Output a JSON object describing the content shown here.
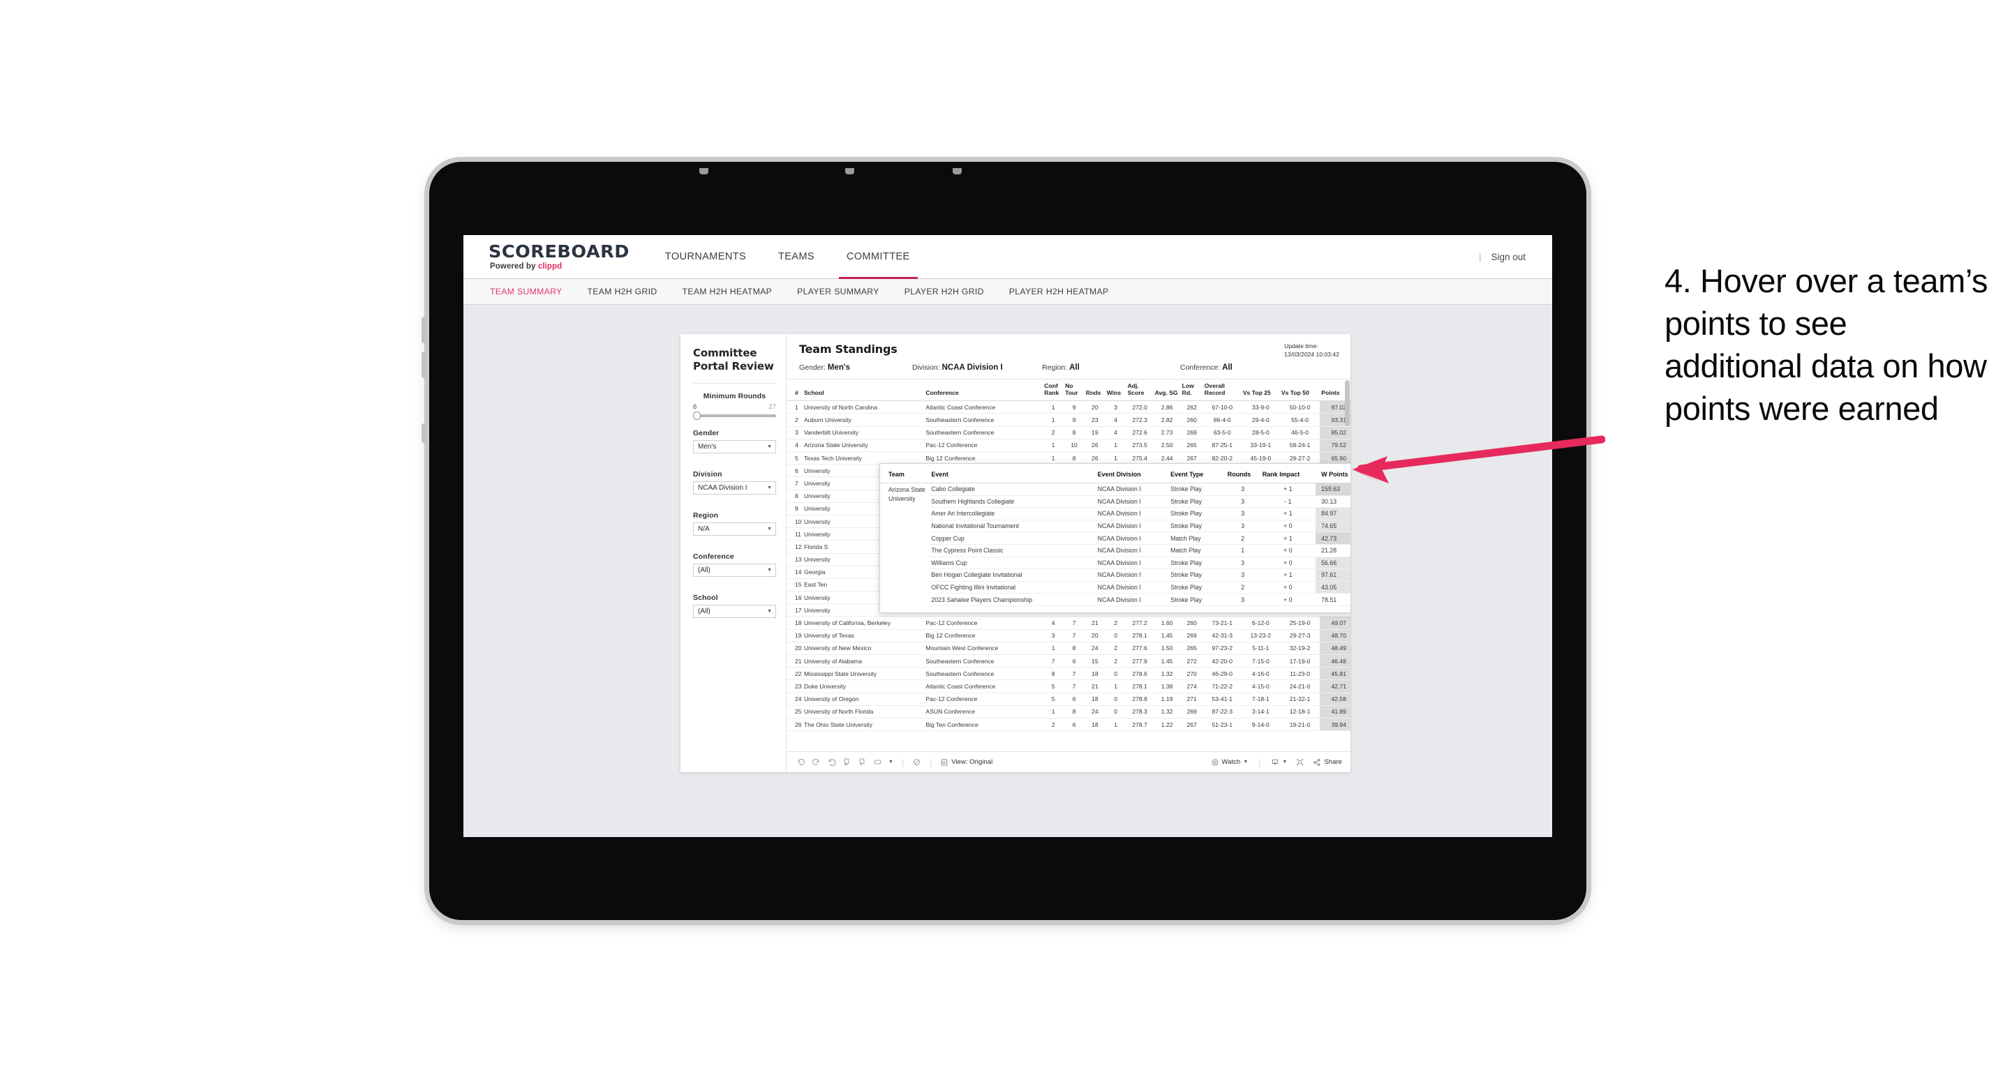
{
  "header": {
    "brand_name": "SCOREBOARD",
    "brand_sub_prefix": "Powered by ",
    "brand_sub_accent": "clippd",
    "nav": [
      {
        "label": "TOURNAMENTS",
        "active": false
      },
      {
        "label": "TEAMS",
        "active": false
      },
      {
        "label": "COMMITTEE",
        "active": true
      }
    ],
    "divider": "|",
    "sign_out": "Sign out"
  },
  "subnav": {
    "tabs": [
      {
        "label": "TEAM SUMMARY",
        "active": true
      },
      {
        "label": "TEAM H2H GRID",
        "active": false
      },
      {
        "label": "TEAM H2H HEATMAP",
        "active": false
      },
      {
        "label": "PLAYER SUMMARY",
        "active": false
      },
      {
        "label": "PLAYER H2H GRID",
        "active": false
      },
      {
        "label": "PLAYER H2H HEATMAP",
        "active": false
      }
    ]
  },
  "filters": {
    "title": "Committee Portal Review",
    "min_rounds": {
      "label": "Minimum Rounds",
      "min": "6",
      "max": "27"
    },
    "gender": {
      "label": "Gender",
      "value": "Men's"
    },
    "division": {
      "label": "Division",
      "value": "NCAA Division I"
    },
    "region": {
      "label": "Region",
      "value": "N/A"
    },
    "conference": {
      "label": "Conference",
      "value": "(All)"
    },
    "school": {
      "label": "School",
      "value": "(All)"
    }
  },
  "sheet": {
    "title": "Team Standings",
    "update_label": "Update time:",
    "update_value": "13/03/2024 10:03:42",
    "summary": [
      {
        "label": "Gender:",
        "value": "Men's"
      },
      {
        "label": "Division:",
        "value": "NCAA Division I"
      },
      {
        "label": "Region:",
        "value": "All"
      },
      {
        "label": "Conference:",
        "value": "All"
      }
    ]
  },
  "table": {
    "headers": {
      "rank": "#",
      "school": "School",
      "conference": "Conference",
      "conf_rank": "Conf Rank",
      "no_tour": "No Tour",
      "rnds": "Rnds",
      "wins": "Wins",
      "adj_score": "Adj. Score",
      "avg_sg": "Avg. SG",
      "low_rd": "Low Rd.",
      "overall_record": "Overall Record",
      "vs_top_25": "Vs Top 25",
      "vs_top_50": "Vs Top 50",
      "points": "Points"
    },
    "rows": [
      {
        "rank": "1",
        "school": "University of North Carolina",
        "conf": "Atlantic Coast Conference",
        "conf_rank": "1",
        "no_tour": "9",
        "rnds": "20",
        "wins": "3",
        "adj": "272.0",
        "sg": "2.86",
        "low": "262",
        "rec": "67-10-0",
        "t25": "33-9-0",
        "t50": "50-10-0",
        "pts": "97.02"
      },
      {
        "rank": "2",
        "school": "Auburn University",
        "conf": "Southeastern Conference",
        "conf_rank": "1",
        "no_tour": "9",
        "rnds": "23",
        "wins": "4",
        "adj": "272.3",
        "sg": "2.82",
        "low": "260",
        "rec": "86-4-0",
        "t25": "29-4-0",
        "t50": "55-4-0",
        "pts": "93.31"
      },
      {
        "rank": "3",
        "school": "Vanderbilt University",
        "conf": "Southeastern Conference",
        "conf_rank": "2",
        "no_tour": "8",
        "rnds": "19",
        "wins": "4",
        "adj": "272.6",
        "sg": "2.73",
        "low": "269",
        "rec": "63-5-0",
        "t25": "28-5-0",
        "t50": "46-5-0",
        "pts": "85.02"
      },
      {
        "rank": "4",
        "school": "Arizona State University",
        "conf": "Pac-12 Conference",
        "conf_rank": "1",
        "no_tour": "10",
        "rnds": "26",
        "wins": "1",
        "adj": "273.5",
        "sg": "2.50",
        "low": "265",
        "rec": "87-25-1",
        "t25": "33-19-1",
        "t50": "58-24-1",
        "pts": "79.52"
      },
      {
        "rank": "5",
        "school": "Texas Tech University",
        "conf": "Big 12 Conference",
        "conf_rank": "1",
        "no_tour": "8",
        "rnds": "26",
        "wins": "1",
        "adj": "275.4",
        "sg": "2.44",
        "low": "267",
        "rec": "82-20-2",
        "t25": "45-19-0",
        "t50": "29-27-2",
        "pts": "65.90"
      },
      {
        "rank": "6",
        "school": "University",
        "conf": "",
        "conf_rank": "",
        "no_tour": "",
        "rnds": "",
        "wins": "",
        "adj": "",
        "sg": "",
        "low": "",
        "rec": "",
        "t25": "",
        "t50": "",
        "pts": ""
      },
      {
        "rank": "7",
        "school": "University",
        "conf": "",
        "conf_rank": "",
        "no_tour": "",
        "rnds": "",
        "wins": "",
        "adj": "",
        "sg": "",
        "low": "",
        "rec": "",
        "t25": "",
        "t50": "",
        "pts": ""
      },
      {
        "rank": "8",
        "school": "University",
        "conf": "",
        "conf_rank": "",
        "no_tour": "",
        "rnds": "",
        "wins": "",
        "adj": "",
        "sg": "",
        "low": "",
        "rec": "",
        "t25": "",
        "t50": "",
        "pts": ""
      },
      {
        "rank": "9",
        "school": "University",
        "conf": "",
        "conf_rank": "",
        "no_tour": "",
        "rnds": "",
        "wins": "",
        "adj": "",
        "sg": "",
        "low": "",
        "rec": "",
        "t25": "",
        "t50": "",
        "pts": ""
      },
      {
        "rank": "10",
        "school": "University",
        "conf": "",
        "conf_rank": "",
        "no_tour": "",
        "rnds": "",
        "wins": "",
        "adj": "",
        "sg": "",
        "low": "",
        "rec": "",
        "t25": "",
        "t50": "",
        "pts": ""
      },
      {
        "rank": "11",
        "school": "University",
        "conf": "",
        "conf_rank": "",
        "no_tour": "",
        "rnds": "",
        "wins": "",
        "adj": "",
        "sg": "",
        "low": "",
        "rec": "",
        "t25": "",
        "t50": "",
        "pts": ""
      },
      {
        "rank": "12",
        "school": "Florida S",
        "conf": "",
        "conf_rank": "",
        "no_tour": "",
        "rnds": "",
        "wins": "",
        "adj": "",
        "sg": "",
        "low": "",
        "rec": "",
        "t25": "",
        "t50": "",
        "pts": ""
      },
      {
        "rank": "13",
        "school": "University",
        "conf": "",
        "conf_rank": "",
        "no_tour": "",
        "rnds": "",
        "wins": "",
        "adj": "",
        "sg": "",
        "low": "",
        "rec": "",
        "t25": "",
        "t50": "",
        "pts": ""
      },
      {
        "rank": "14",
        "school": "Georgia",
        "conf": "",
        "conf_rank": "",
        "no_tour": "",
        "rnds": "",
        "wins": "",
        "adj": "",
        "sg": "",
        "low": "",
        "rec": "",
        "t25": "",
        "t50": "",
        "pts": ""
      },
      {
        "rank": "15",
        "school": "East Ten",
        "conf": "",
        "conf_rank": "",
        "no_tour": "",
        "rnds": "",
        "wins": "",
        "adj": "",
        "sg": "",
        "low": "",
        "rec": "",
        "t25": "",
        "t50": "",
        "pts": ""
      },
      {
        "rank": "16",
        "school": "University",
        "conf": "",
        "conf_rank": "",
        "no_tour": "",
        "rnds": "",
        "wins": "",
        "adj": "",
        "sg": "",
        "low": "",
        "rec": "",
        "t25": "",
        "t50": "",
        "pts": ""
      },
      {
        "rank": "17",
        "school": "University",
        "conf": "",
        "conf_rank": "",
        "no_tour": "",
        "rnds": "",
        "wins": "",
        "adj": "",
        "sg": "",
        "low": "",
        "rec": "",
        "t25": "",
        "t50": "",
        "pts": ""
      },
      {
        "rank": "18",
        "school": "University of California, Berkeley",
        "conf": "Pac-12 Conference",
        "conf_rank": "4",
        "no_tour": "7",
        "rnds": "21",
        "wins": "2",
        "adj": "277.2",
        "sg": "1.60",
        "low": "260",
        "rec": "73-21-1",
        "t25": "6-12-0",
        "t50": "25-19-0",
        "pts": "49.07"
      },
      {
        "rank": "19",
        "school": "University of Texas",
        "conf": "Big 12 Conference",
        "conf_rank": "3",
        "no_tour": "7",
        "rnds": "20",
        "wins": "0",
        "adj": "278.1",
        "sg": "1.45",
        "low": "269",
        "rec": "42-31-3",
        "t25": "13-23-2",
        "t50": "29-27-3",
        "pts": "48.70"
      },
      {
        "rank": "20",
        "school": "University of New Mexico",
        "conf": "Mountain West Conference",
        "conf_rank": "1",
        "no_tour": "8",
        "rnds": "24",
        "wins": "2",
        "adj": "277.6",
        "sg": "1.50",
        "low": "265",
        "rec": "97-23-2",
        "t25": "5-11-1",
        "t50": "32-19-2",
        "pts": "48.49"
      },
      {
        "rank": "21",
        "school": "University of Alabama",
        "conf": "Southeastern Conference",
        "conf_rank": "7",
        "no_tour": "6",
        "rnds": "15",
        "wins": "2",
        "adj": "277.9",
        "sg": "1.45",
        "low": "272",
        "rec": "42-20-0",
        "t25": "7-15-0",
        "t50": "17-19-0",
        "pts": "46.48"
      },
      {
        "rank": "22",
        "school": "Mississippi State University",
        "conf": "Southeastern Conference",
        "conf_rank": "8",
        "no_tour": "7",
        "rnds": "18",
        "wins": "0",
        "adj": "278.6",
        "sg": "1.32",
        "low": "270",
        "rec": "46-29-0",
        "t25": "4-16-0",
        "t50": "11-23-0",
        "pts": "45.81"
      },
      {
        "rank": "23",
        "school": "Duke University",
        "conf": "Atlantic Coast Conference",
        "conf_rank": "5",
        "no_tour": "7",
        "rnds": "21",
        "wins": "1",
        "adj": "278.1",
        "sg": "1.38",
        "low": "274",
        "rec": "71-22-2",
        "t25": "4-15-0",
        "t50": "24-21-0",
        "pts": "42.71"
      },
      {
        "rank": "24",
        "school": "University of Oregon",
        "conf": "Pac-12 Conference",
        "conf_rank": "5",
        "no_tour": "6",
        "rnds": "18",
        "wins": "0",
        "adj": "278.8",
        "sg": "1.19",
        "low": "271",
        "rec": "53-41-1",
        "t25": "7-18-1",
        "t50": "21-32-1",
        "pts": "42.58"
      },
      {
        "rank": "25",
        "school": "University of North Florida",
        "conf": "ASUN Conference",
        "conf_rank": "1",
        "no_tour": "8",
        "rnds": "24",
        "wins": "0",
        "adj": "278.3",
        "sg": "1.32",
        "low": "269",
        "rec": "87-22-3",
        "t25": "3-14-1",
        "t50": "12-18-1",
        "pts": "41.89"
      },
      {
        "rank": "26",
        "school": "The Ohio State University",
        "conf": "Big Ten Conference",
        "conf_rank": "2",
        "no_tour": "6",
        "rnds": "18",
        "wins": "1",
        "adj": "278.7",
        "sg": "1.22",
        "low": "267",
        "rec": "51-23-1",
        "t25": "9-14-0",
        "t50": "19-21-0",
        "pts": "39.94"
      }
    ]
  },
  "tooltip": {
    "headers": {
      "team": "Team",
      "event": "Event",
      "event_division": "Event Division",
      "event_type": "Event Type",
      "rounds": "Rounds",
      "rank_impact": "Rank Impact",
      "w_points": "W Points"
    },
    "team": "Arizona State University",
    "rows": [
      {
        "event": "Cabo Collegiate",
        "division": "NCAA Division I",
        "type": "Stroke Play",
        "rounds": "3",
        "impact": "+ 1",
        "wpoints": "159.63",
        "highlight": "strong"
      },
      {
        "event": "Southern Highlands Collegiate",
        "division": "NCAA Division I",
        "type": "Stroke Play",
        "rounds": "3",
        "impact": "- 1",
        "wpoints": "30.13",
        "highlight": "none"
      },
      {
        "event": "Amer Ari Intercollegiate",
        "division": "NCAA Division I",
        "type": "Stroke Play",
        "rounds": "3",
        "impact": "+ 1",
        "wpoints": "84.97",
        "highlight": "light"
      },
      {
        "event": "National Invitational Tournament",
        "division": "NCAA Division I",
        "type": "Stroke Play",
        "rounds": "3",
        "impact": "+ 0",
        "wpoints": "74.65",
        "highlight": "light"
      },
      {
        "event": "Copper Cup",
        "division": "NCAA Division I",
        "type": "Match Play",
        "rounds": "2",
        "impact": "+ 1",
        "wpoints": "42.73",
        "highlight": "strong"
      },
      {
        "event": "The Cypress Point Classic",
        "division": "NCAA Division I",
        "type": "Match Play",
        "rounds": "1",
        "impact": "+ 0",
        "wpoints": "21.28",
        "highlight": "none"
      },
      {
        "event": "Williams Cup",
        "division": "NCAA Division I",
        "type": "Stroke Play",
        "rounds": "3",
        "impact": "+ 0",
        "wpoints": "56.66",
        "highlight": "light"
      },
      {
        "event": "Ben Hogan Collegiate Invitational",
        "division": "NCAA Division I",
        "type": "Stroke Play",
        "rounds": "3",
        "impact": "+ 1",
        "wpoints": "97.61",
        "highlight": "light"
      },
      {
        "event": "OFCC Fighting Illini Invitational",
        "division": "NCAA Division I",
        "type": "Stroke Play",
        "rounds": "2",
        "impact": "+ 0",
        "wpoints": "43.05",
        "highlight": "light"
      },
      {
        "event": "2023 Sahalee Players Championship",
        "division": "NCAA Division I",
        "type": "Stroke Play",
        "rounds": "3",
        "impact": "+ 0",
        "wpoints": "78.51",
        "highlight": "none"
      }
    ]
  },
  "toolbar": {
    "view_label": "View: Original",
    "watch_label": "Watch",
    "share_label": "Share",
    "separator": "|"
  },
  "annotation": {
    "text": "4. Hover over a team’s points to see additional data on how points were earned",
    "arrow_color": "#e8295c"
  }
}
